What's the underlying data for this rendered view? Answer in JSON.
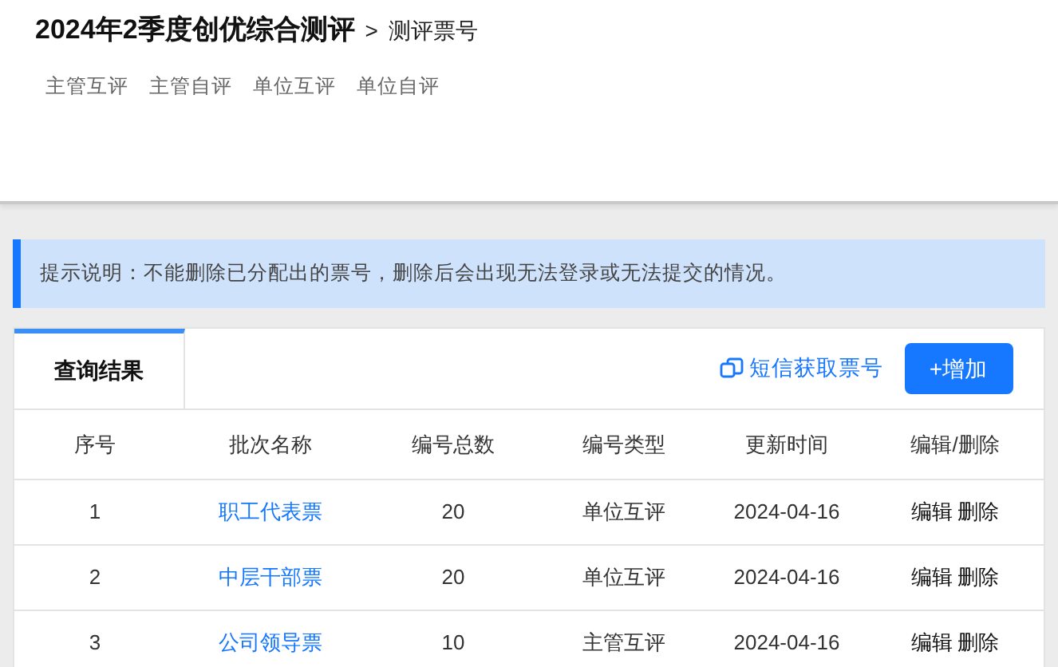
{
  "header": {
    "title": "2024年2季度创优综合测评",
    "separator": ">",
    "subtitle": "测评票号"
  },
  "nav": [
    "主管互评",
    "主管自评",
    "单位互评",
    "单位自评"
  ],
  "notice": "提示说明：不能删除已分配出的票号，删除后会出现无法登录或无法提交的情况。",
  "tabs": [
    {
      "label": "查询结果",
      "selected": true
    }
  ],
  "actions": {
    "sms_link": "短信获取票号",
    "add_button": "+增加"
  },
  "table": {
    "columns": [
      "序号",
      "批次名称",
      "编号总数",
      "编号类型",
      "更新时间",
      "编辑/删除"
    ],
    "rows": [
      {
        "index": "1",
        "name": "职工代表票",
        "total": "20",
        "type": "单位互评",
        "updated": "2024-04-16",
        "edit": "编辑",
        "delete": "删除"
      },
      {
        "index": "2",
        "name": "中层干部票",
        "total": "20",
        "type": "单位互评",
        "updated": "2024-04-16",
        "edit": "编辑",
        "delete": "删除"
      },
      {
        "index": "3",
        "name": "公司领导票",
        "total": "10",
        "type": "主管互评",
        "updated": "2024-04-16",
        "edit": "编辑",
        "delete": "删除"
      }
    ]
  }
}
